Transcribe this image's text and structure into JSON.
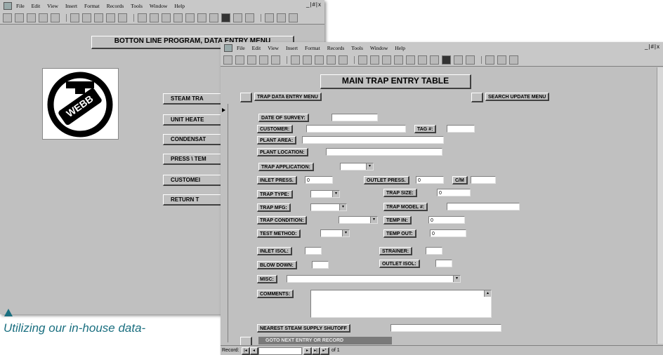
{
  "back_window": {
    "menu": [
      "File",
      "Edit",
      "View",
      "Insert",
      "Format",
      "Records",
      "Tools",
      "Window",
      "Help"
    ],
    "controls": "_|#|x",
    "title": "BOTTON LINE PROGRAM, DATA ENTRY MENU",
    "logo_text": "WEBB",
    "buttons": [
      "STEAM TRA",
      "UNIT HEATE",
      "CONDENSAT",
      "PRESS \\ TEM",
      "CUSTOMEI",
      "RETURN T"
    ]
  },
  "front_window": {
    "menu": [
      "File",
      "Edit",
      "View",
      "Insert",
      "Format",
      "Records",
      "Tools",
      "Window",
      "Help"
    ],
    "controls": "_|#|x",
    "title": "MAIN TRAP ENTRY TABLE",
    "nav_left": "TRAP DATA ENTRY MENU",
    "nav_right": "SEARCH UPDATE MENU",
    "labels": {
      "date_of_survey": "DATE OF SURVEY:",
      "customer": "CUSTOMER:",
      "tag": "TAG #:",
      "plant_area": "PLANT AREA:",
      "plant_location": "PLANT LOCATION:",
      "trap_application": "TRAP APPLICATION:",
      "inlet_press": "INLET PRESS.",
      "outlet_press": "OUTLET PRESS.",
      "cm": "C/M",
      "trap_type": "TRAP TYPE:",
      "trap_size": "TRAP SIZE:",
      "trap_mfg": "TRAP MFG:",
      "trap_model": "TRAP MODEL #:",
      "trap_condition": "TRAP CONDITION:",
      "temp_in": "TEMP IN:",
      "test_method": "TEST METHOD:",
      "temp_out": "TEMP OUT:",
      "inlet_isol": "INLET ISOL:",
      "strainer": "STRAINER:",
      "blow_down": "BLOW DOWN:",
      "outlet_isol": "OUTLET ISOL:",
      "misc": "MISC:",
      "comments": "COMMENTS:",
      "nearest_shutoff": "NEAREST STEAM SUPPLY SHUTOFF"
    },
    "values": {
      "inlet_press": "0",
      "outlet_press": "0",
      "trap_size": "0",
      "temp_in": "0",
      "temp_out": "0"
    },
    "goto_next": "GOTO NEXT ENTRY OR RECORD",
    "record_label": "Record:",
    "record_of": "of 1"
  },
  "caption": "Utilizing our in-house data-"
}
